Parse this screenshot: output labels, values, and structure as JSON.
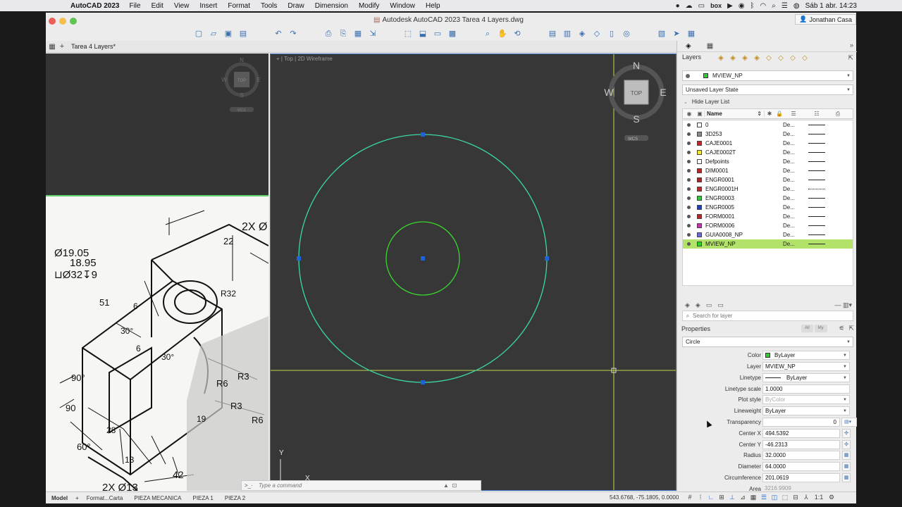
{
  "menubar": {
    "app_name": "AutoCAD 2023",
    "items": [
      "File",
      "Edit",
      "View",
      "Insert",
      "Format",
      "Tools",
      "Draw",
      "Dimension",
      "Modify",
      "Window",
      "Help"
    ],
    "box_label": "box",
    "clock": "Sáb 1 abr.  14:23"
  },
  "window": {
    "title": "Autodesk AutoCAD 2023   Tarea 4 Layers.dwg",
    "user": "Jonathan Casa",
    "doc_tab": "Tarea 4 Layers*"
  },
  "viewport": {
    "label": "[ – ] [ Top ] [ 2D Wireframe ]",
    "label_short": "+ | Top | 2D Wireframe",
    "viewcube_face": "TOP",
    "compass": {
      "n": "N",
      "s": "S",
      "e": "E",
      "w": "W"
    },
    "wcs": "WCS",
    "axis_y": "Y",
    "axis_x": "X",
    "circle_color": "#3ad7a8",
    "inner_circle_color": "#39d62f",
    "grip_color": "#1e64d8"
  },
  "reference_drawing": {
    "texts": [
      "2X Ø",
      "Ø19.05",
      "18.95",
      "⊔Ø32↧9",
      "22",
      "R32",
      "51",
      "6",
      "30°",
      "30°",
      "6",
      "R6",
      "R3",
      "R3",
      "R6",
      "90°",
      "90",
      "28",
      "60°",
      "19",
      "13",
      "42",
      "2X Ø13"
    ]
  },
  "command_line": {
    "prompt": ">_·",
    "placeholder": "Type a command"
  },
  "statusbar": {
    "layouts": [
      "Model",
      "Format...Carta",
      "PIEZA MECANICA",
      "PIEZA 1",
      "PIEZA 2"
    ],
    "coordinates": "543.6768, -75.1805, 0.0000",
    "scale": "1:1"
  },
  "palette": {
    "layers_title": "Layers",
    "current_layer": "MVIEW_NP",
    "layer_state": "Unsaved Layer State",
    "hide_list": "Hide Layer List",
    "name_header": "Name",
    "layers": [
      {
        "name": "0",
        "color": "#ffffff",
        "lt": "De...",
        "dotted": false
      },
      {
        "name": "3D253",
        "color": "#8a8a8a",
        "lt": "De...",
        "dotted": false
      },
      {
        "name": "CAJE0001",
        "color": "#c0262e",
        "lt": "De...",
        "dotted": false
      },
      {
        "name": "CAJE0002T",
        "color": "#f2ea2b",
        "lt": "De...",
        "dotted": false
      },
      {
        "name": "Defpoints",
        "color": "#ffffff",
        "lt": "De...",
        "dotted": false
      },
      {
        "name": "DIM0001",
        "color": "#b7262b",
        "lt": "De...",
        "dotted": false
      },
      {
        "name": "ENGR0001",
        "color": "#a8242a",
        "lt": "De...",
        "dotted": false
      },
      {
        "name": "ENGR0001H",
        "color": "#b52b30",
        "lt": "De...",
        "dotted": true
      },
      {
        "name": "ENGR0003",
        "color": "#34c43a",
        "lt": "De...",
        "dotted": false
      },
      {
        "name": "ENGR0005",
        "color": "#1e3fb8",
        "lt": "De...",
        "dotted": false
      },
      {
        "name": "FORM0001",
        "color": "#b2262c",
        "lt": "De...",
        "dotted": false
      },
      {
        "name": "FORM0006",
        "color": "#c42fb6",
        "lt": "De...",
        "dotted": false
      },
      {
        "name": "GUIA0008_NP",
        "color": "#6a6ad0",
        "lt": "De...",
        "dotted": false
      },
      {
        "name": "MVIEW_NP",
        "color": "#2bd22b",
        "lt": "De...",
        "dotted": false,
        "selected": true
      }
    ],
    "search_placeholder": "Search for layer",
    "properties_title": "Properties",
    "tab_all": "All",
    "tab_my": "My",
    "object_type": "Circle",
    "props": {
      "color_label": "Color",
      "color_value": "ByLayer",
      "layer_label": "Layer",
      "layer_value": "MVIEW_NP",
      "linetype_label": "Linetype",
      "linetype_value": "ByLayer",
      "ltscale_label": "Linetype scale",
      "ltscale_value": "1.0000",
      "plotstyle_label": "Plot style",
      "plotstyle_value": "ByColor",
      "lineweight_label": "Lineweight",
      "lineweight_value": "ByLayer",
      "transparency_label": "Transparency",
      "transparency_value": "0",
      "centerx_label": "Center X",
      "centerx_value": "494.5392",
      "centery_label": "Center Y",
      "centery_value": "-46.2313",
      "radius_label": "Radius",
      "radius_value": "32.0000",
      "diameter_label": "Diameter",
      "diameter_value": "64.0000",
      "circumference_label": "Circumference",
      "circumference_value": "201.0619",
      "area_label": "Area",
      "area_value": "3216.9909"
    }
  }
}
